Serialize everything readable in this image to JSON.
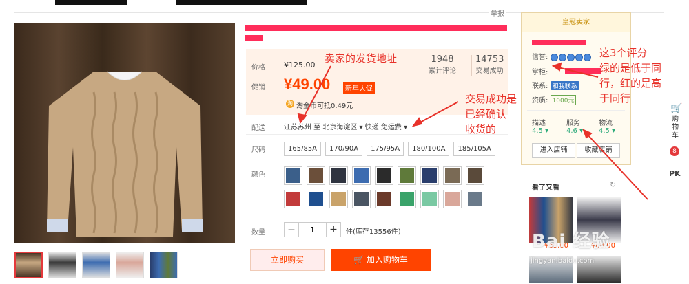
{
  "header": {
    "report_label": "举报"
  },
  "product": {
    "labels": {
      "price": "价格",
      "promo": "促销",
      "delivery": "配送",
      "size": "尺码",
      "color": "颜色",
      "quantity": "数量"
    },
    "original_price": "¥125.00",
    "promo_price": "¥49.00",
    "promo_tag": "新年大促",
    "coupon_icon": "淘",
    "coupon_text": "淘金币可抵0.49元",
    "stats": {
      "reviews_value": "1948",
      "reviews_label": "累计评论",
      "deals_value": "14753",
      "deals_label": "交易成功"
    },
    "shipping": "江苏苏州 至 北京海淀区 ▾ 快递 免运费 ▾",
    "sizes": [
      "165/85A",
      "170/90A",
      "175/95A",
      "180/100A",
      "185/105A"
    ],
    "color_swatches": [
      "#3b5f8a",
      "#6b4f3a",
      "#2f3440",
      "#3d6cb0",
      "#2b2b2b",
      "#5f7a3a",
      "#2a3e6c",
      "#7a6a55",
      "#5a4a3a",
      "#c23b3b",
      "#1f4f8f",
      "#c9a36a",
      "#4a5563",
      "#6b3a2a",
      "#3aa36a",
      "#7ac9a3",
      "#d9a79a",
      "#6a7a8a"
    ],
    "quantity_value": "1",
    "stock_text": "件(库存13556件)",
    "buy_now": "立即购买",
    "add_cart": "加入购物车",
    "icons": [
      "magnifier-icon",
      "coin-icon",
      "cart-icon",
      "minus-icon",
      "plus-icon"
    ]
  },
  "shop": {
    "badge": "皇冠卖家",
    "credit_label": "信誉:",
    "keeper_label": "掌柜:",
    "contact_label": "联系:",
    "contact_badge": "和我联系",
    "deposit_label": "资质:",
    "deposit_value": "1000元",
    "ratings": [
      {
        "name": "描述",
        "value": "4.5 ▾"
      },
      {
        "name": "服务",
        "value": "4.6 ▾"
      },
      {
        "name": "物流",
        "value": "4.5 ▾"
      }
    ],
    "enter_shop": "进入店铺",
    "favorite_shop": "收藏店铺",
    "rating_color": "#2eab7c"
  },
  "see_also": {
    "title": "看了又看",
    "prices": [
      "¥69.00",
      "¥88.00"
    ]
  },
  "sidebar": {
    "cart_label": "购物车",
    "cart_count": "8",
    "pk": "PK"
  },
  "annotations": {
    "address": "卖家的发货地址",
    "success": "交易成功是\n已经确认\n收货的",
    "ratings": "这3个评分\n绿的是低于同\n行，红的是高\n于同行"
  },
  "watermark": {
    "main": "Bai 经验",
    "url": "jingyan.baidu.com"
  },
  "colors": {
    "accent": "#ff4400",
    "annotation": "#e8322a",
    "highlight": "#ff2d5a"
  }
}
